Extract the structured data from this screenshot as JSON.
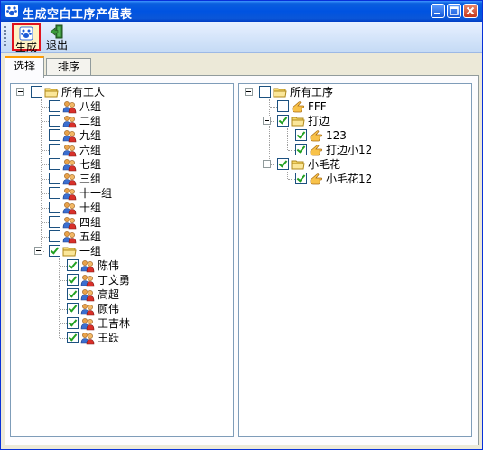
{
  "window": {
    "title": "生成空白工序产值表"
  },
  "toolbar": {
    "generate_label": "生成",
    "exit_label": "退出"
  },
  "tabs": [
    {
      "label": "选择"
    },
    {
      "label": "排序"
    }
  ],
  "left_tree": {
    "root": "所有工人",
    "groups": [
      "八组",
      "二组",
      "九组",
      "六组",
      "七组",
      "三组",
      "十一组",
      "十组",
      "四组",
      "五组",
      "一组"
    ],
    "members": [
      "陈伟",
      "丁文勇",
      "高超",
      "顾伟",
      "王吉林",
      "王跃"
    ]
  },
  "right_tree": {
    "root": "所有工序",
    "items": [
      "FFF",
      "打边",
      "123",
      "打边小12",
      "小毛花",
      "小毛花12"
    ]
  },
  "colors": {
    "title_bar": "#0053e1",
    "tab_accent": "#ff9c00",
    "check": "#21a121",
    "highlight_border": "#e0141e"
  }
}
